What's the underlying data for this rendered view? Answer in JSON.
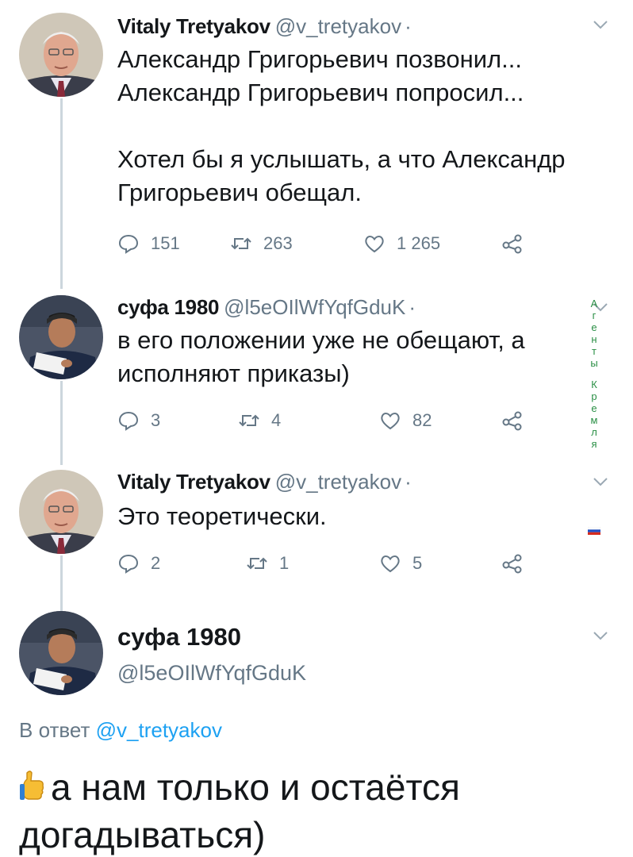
{
  "tweets": [
    {
      "name": "Vitaly Tretyakov",
      "handle": "@v_tretyakov",
      "dot": "·",
      "text": "Александр Григорьевич позвонил...\nАлександр Григорьевич попросил...\n\nХотел бы я услышать, а что Александр Григорьевич обещал.",
      "replies": "151",
      "retweets": "263",
      "likes": "1 265"
    },
    {
      "name": "суфа 1980",
      "handle": "@l5eOIlWfYqfGduK",
      "dot": "·",
      "text": "в его положении уже не обещают, а исполняют приказы)",
      "replies": "3",
      "retweets": "4",
      "likes": "82"
    },
    {
      "name": "Vitaly Tretyakov",
      "handle": "@v_tretyakov",
      "dot": "·",
      "text": "Это теоретически.",
      "replies": "2",
      "retweets": "1",
      "likes": "5"
    }
  ],
  "main": {
    "name": "суфа 1980",
    "handle": "@l5eOIlWfYqfGduK",
    "reply_prefix": "В ответ ",
    "reply_handle": "@v_tretyakov",
    "text": "а нам только и остаётся догадываться)"
  },
  "watermark": {
    "word1": [
      "А",
      "г",
      "е",
      "н",
      "т",
      "ы"
    ],
    "word2": [
      "К",
      "р",
      "е",
      "м",
      "л",
      "я"
    ]
  },
  "colors": {
    "muted": "#657786",
    "link": "#1da1f2",
    "thread_line": "#ccd6dd",
    "watermark": "#2a8f45"
  },
  "icons": [
    "reply-icon",
    "retweet-icon",
    "like-icon",
    "share-icon",
    "caret-down-icon",
    "thumbs-up-emoji",
    "russia-flag-icon"
  ]
}
